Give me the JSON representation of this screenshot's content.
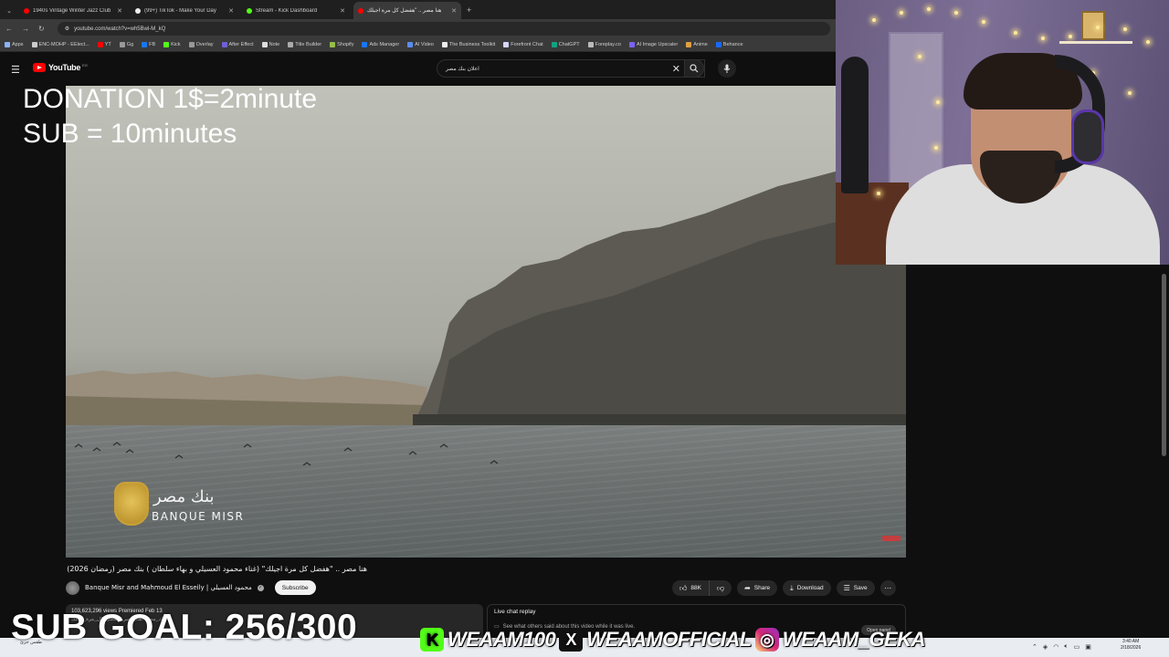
{
  "browser": {
    "tabs": [
      {
        "title": "1940s Vintage Winter Jazz Club",
        "color": "#ff0000",
        "active": false
      },
      {
        "title": "(99+) TikTok - Make Your Day",
        "color": "#222222",
        "active": false
      },
      {
        "title": "Stream - Kick Dashboard",
        "color": "#53fc18",
        "active": false
      },
      {
        "title": "هنا مصر .. \"هفضل كل مرة اجيلك",
        "color": "#ff0000",
        "active": true
      }
    ],
    "new_tab": "+",
    "url": "youtube.com/watch?v=wh5Bwl-M_kQ",
    "bookmarks": [
      "Apps",
      "ENC-MOHP - EElect...",
      "YT",
      "Gg",
      "FB",
      "Kick",
      "Overlay",
      "After Effect",
      "Note",
      "Title Builder",
      "Shopify",
      "Ads Manager",
      "AI Video",
      "The Business Toolkit",
      "Forefront Chat",
      "ChatGPT",
      "Foreplay.co",
      "AI Image Upscaler",
      "Anime",
      "Behance"
    ]
  },
  "youtube": {
    "logo": "YouTube",
    "logo_cc": "EG",
    "search_query": "اعلان بنك مصر",
    "clear": "✕"
  },
  "overlay": {
    "donation_line1": "DONATION 1$=2minute",
    "donation_line2": "SUB = 10minutes",
    "sub_goal": "SUB GOAL: 256/300",
    "socials": [
      {
        "icon": "K",
        "handle": "WEAAM100",
        "kind": "kick"
      },
      {
        "icon": "X",
        "handle": "WEAAMOFFICIAL",
        "kind": "x"
      },
      {
        "icon": "◎",
        "handle": "WEAAM_GEKA",
        "kind": "ig"
      }
    ]
  },
  "video": {
    "watermark_arabic": "بنك مصر",
    "watermark_en": "BANQUE MISR",
    "title": "هنا مصر .. \"هفضل كل مرة اجيلك\" (غناء محمود العسيلي و بهاء سلطان ) بنك مصر (رمضان 2026)",
    "channel": "Banque Misr and Mahmoud El Esseily | محمود العسيلي",
    "subscribe": "Subscribe",
    "likes": "88K",
    "share": "Share",
    "download": "Download",
    "save": "Save",
    "desc_line1": "103,623,296 views  Premiered Feb 13",
    "desc_line2": "#بنك_مصر #هنا_مصر #هفضل_كل_مرة_اجيلك",
    "chat_title": "Live chat replay",
    "chat_sub": "See what others said about this video while it was live.",
    "open_panel": "Open panel"
  },
  "taskbar": {
    "left_label": "طقس جزئ",
    "time": "3:40 AM",
    "date": "2/18/2026"
  }
}
